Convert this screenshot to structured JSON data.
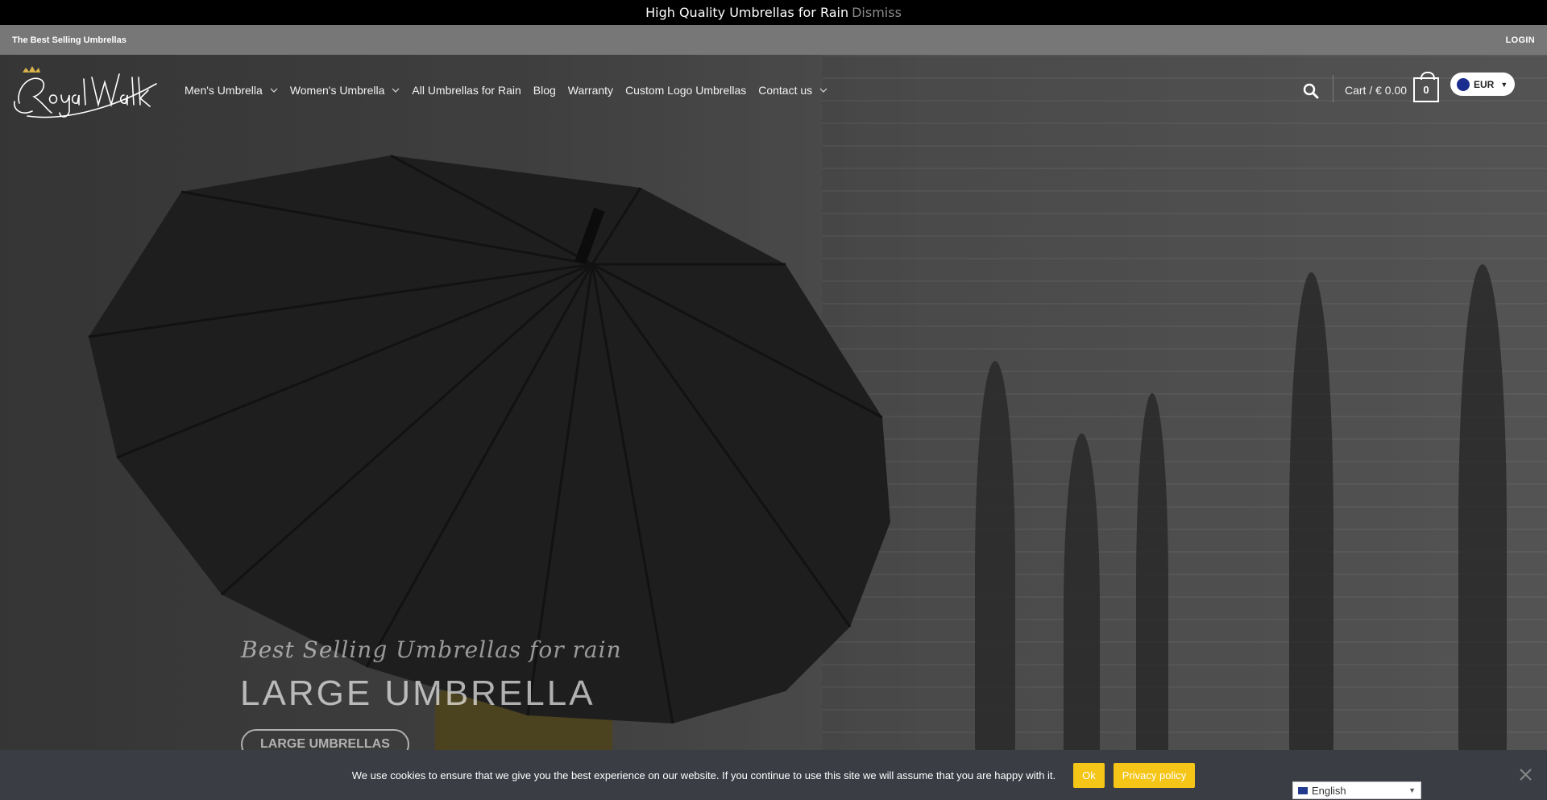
{
  "announcement": {
    "text": "High Quality Umbrellas for Rain",
    "dismiss": "Dismiss"
  },
  "topbar": {
    "left_text": "The Best Selling Umbrellas",
    "login": "LOGIN"
  },
  "logo": {
    "text": "Royal Walk"
  },
  "nav": {
    "items": [
      {
        "label": "Men's Umbrella",
        "has_dropdown": true
      },
      {
        "label": "Women's Umbrella",
        "has_dropdown": true
      },
      {
        "label": "All Umbrellas for Rain",
        "has_dropdown": false
      },
      {
        "label": "Blog",
        "has_dropdown": false
      },
      {
        "label": "Warranty",
        "has_dropdown": false
      },
      {
        "label": "Custom Logo Umbrellas",
        "has_dropdown": false
      },
      {
        "label": "Contact us",
        "has_dropdown": true
      }
    ]
  },
  "cart": {
    "label": "Cart / € 0.00",
    "count": "0"
  },
  "currency": {
    "selected": "EUR"
  },
  "hero": {
    "tagline": "Best Selling Umbrellas for rain",
    "headline": "LARGE UMBRELLA",
    "button": "LARGE UMBRELLAS"
  },
  "cookie": {
    "message": "We use cookies to ensure that we give you the best experience on our website. If you continue to use this site we will assume that you are happy with it.",
    "ok": "Ok",
    "privacy": "Privacy policy"
  },
  "language": {
    "selected": "English"
  },
  "colors": {
    "cookie_button": "#f5c518",
    "announce_bg": "#000000",
    "cookie_bg": "#3a3d44"
  }
}
